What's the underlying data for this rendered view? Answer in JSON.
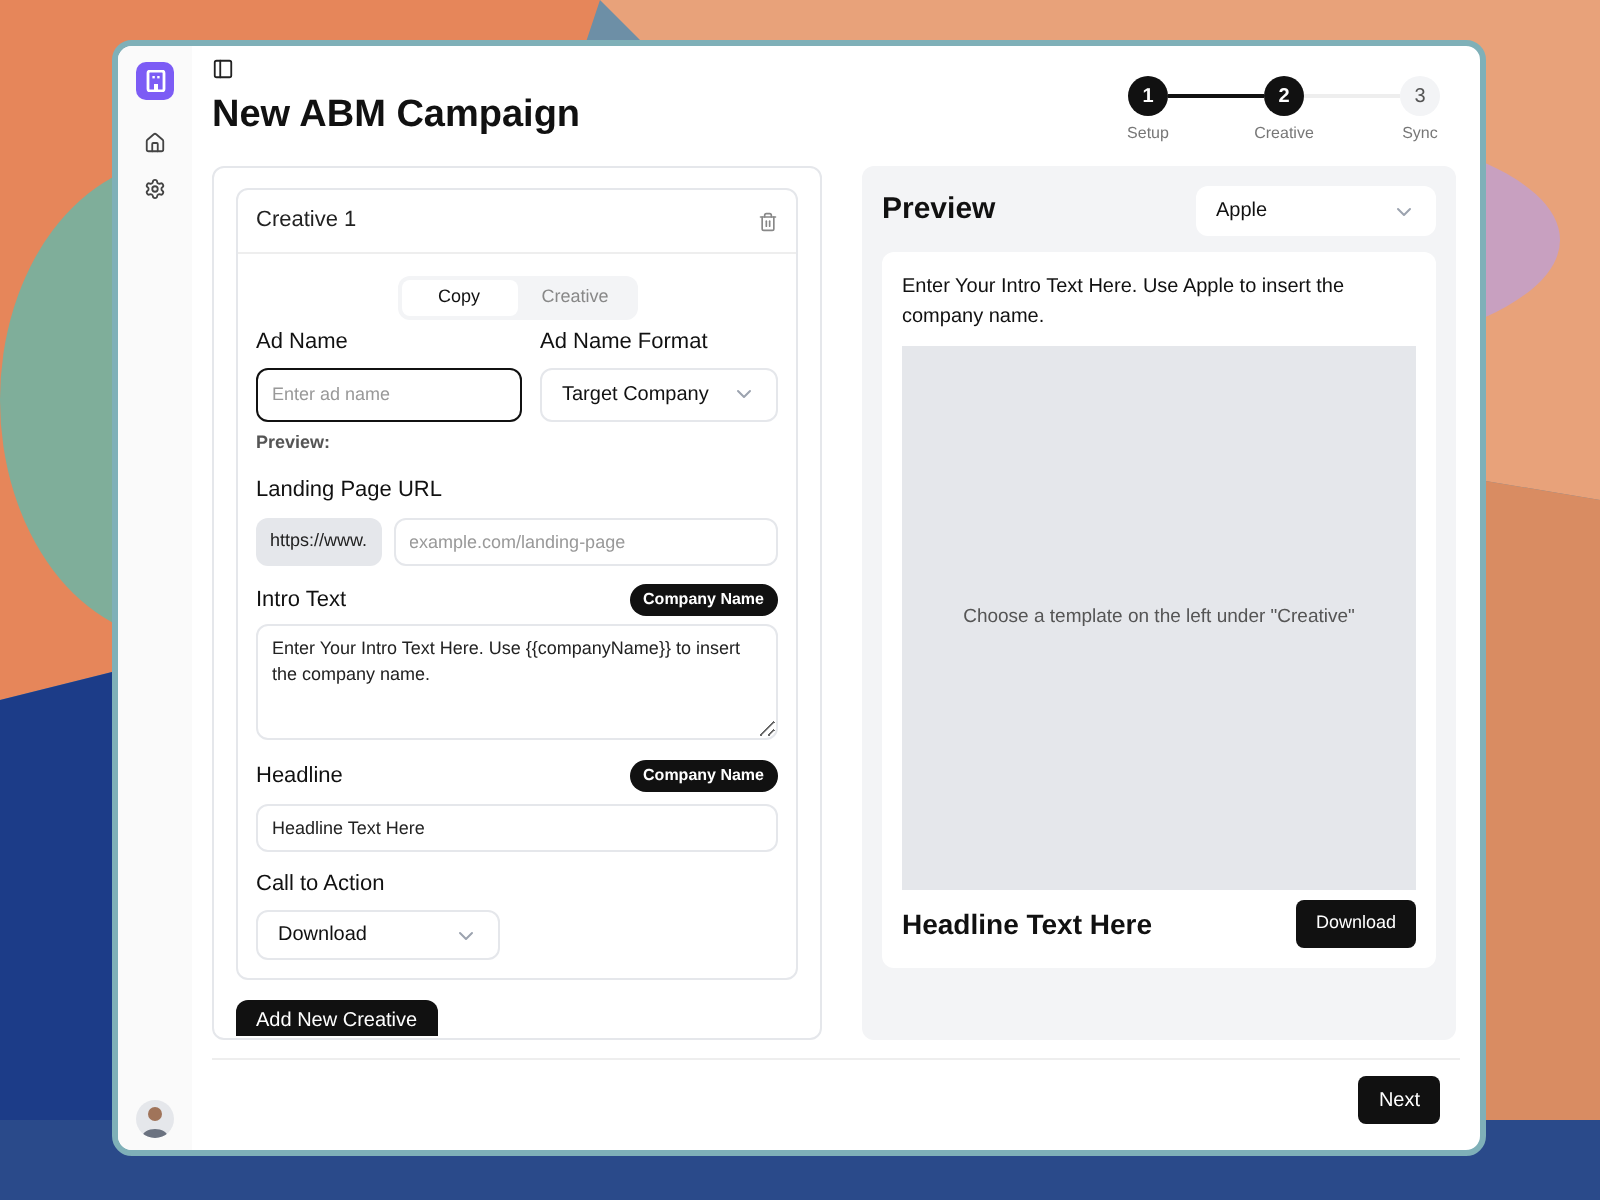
{
  "page": {
    "title": "New ABM Campaign"
  },
  "stepper": [
    {
      "number": "1",
      "label": "Setup",
      "done": true
    },
    {
      "number": "2",
      "label": "Creative",
      "done": true
    },
    {
      "number": "3",
      "label": "Sync",
      "done": false
    }
  ],
  "creative": {
    "title": "Creative 1",
    "tabs": [
      {
        "label": "Copy",
        "selected": true
      },
      {
        "label": "Creative",
        "selected": false
      }
    ],
    "ad_name": {
      "label": "Ad Name",
      "placeholder": "Enter ad name",
      "focused": true
    },
    "ad_name_format": {
      "label": "Ad Name Format",
      "value": "Target Company"
    },
    "preview_label": "Preview:",
    "landing_page": {
      "label": "Landing Page URL",
      "prefix": "https://www.",
      "placeholder": "example.com/landing-page"
    },
    "intro_text": {
      "label": "Intro Text",
      "badge": "Company Name",
      "value": "Enter Your Intro Text Here. Use {{companyName}} to insert the company name."
    },
    "headline": {
      "label": "Headline",
      "badge": "Company Name",
      "value": "Headline Text Here"
    },
    "call_to_action": {
      "label": "Call to Action",
      "value": "Download"
    }
  },
  "add_button": "Add New Creative",
  "preview": {
    "title": "Preview",
    "company": "Apple",
    "intro": "Enter Your Intro Text Here. Use Apple to insert the company name.",
    "image_hint": "Choose a template on the left under \"Creative\"",
    "headline": "Headline Text Here",
    "cta": "Download"
  },
  "footer": {
    "next": "Next"
  }
}
